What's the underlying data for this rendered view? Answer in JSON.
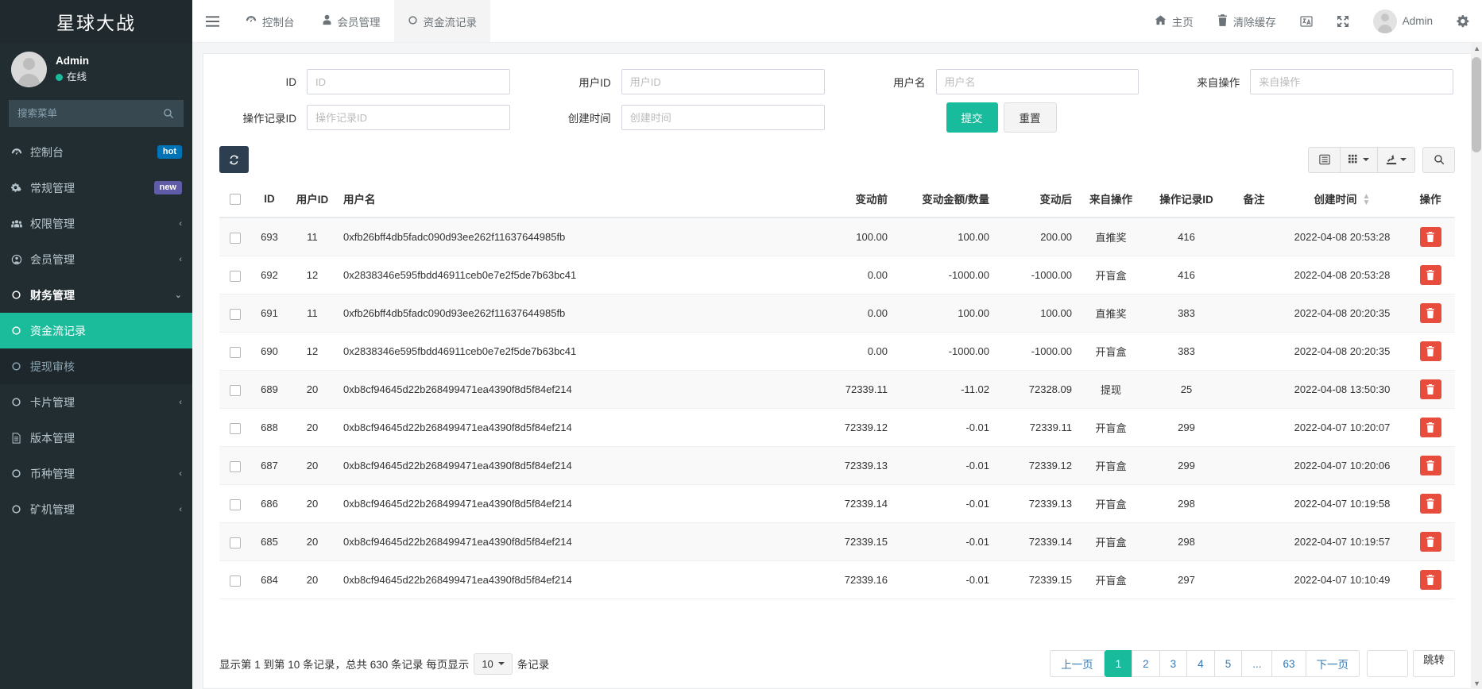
{
  "sidebar": {
    "brand": "星球大战",
    "user": {
      "name": "Admin",
      "status": "在线"
    },
    "search_placeholder": "搜索菜单",
    "items": [
      {
        "label": "控制台",
        "icon": "dashboard-icon",
        "badge": "hot",
        "badge_color": "#0073b7",
        "arrow": ""
      },
      {
        "label": "常规管理",
        "icon": "gears-icon",
        "badge": "new",
        "badge_color": "#605ca8",
        "arrow": ""
      },
      {
        "label": "权限管理",
        "icon": "users-icon",
        "badge": "",
        "arrow": "‹"
      },
      {
        "label": "会员管理",
        "icon": "user-circle-icon",
        "badge": "",
        "arrow": "‹"
      },
      {
        "label": "财务管理",
        "icon": "circle-icon",
        "badge": "",
        "arrow": "⌄"
      },
      {
        "label": "资金流记录",
        "icon": "circle-icon",
        "badge": "",
        "arrow": ""
      },
      {
        "label": "提现审核",
        "icon": "circle-icon",
        "badge": "",
        "arrow": ""
      },
      {
        "label": "卡片管理",
        "icon": "circle-icon",
        "badge": "",
        "arrow": "‹"
      },
      {
        "label": "版本管理",
        "icon": "file-icon",
        "badge": "",
        "arrow": ""
      },
      {
        "label": "币种管理",
        "icon": "circle-icon",
        "badge": "",
        "arrow": "‹"
      },
      {
        "label": "矿机管理",
        "icon": "circle-icon",
        "badge": "",
        "arrow": "‹"
      }
    ],
    "active_index": 5,
    "active_parent_index": 4,
    "dim_index": 6,
    "active_color": "#1abc9c"
  },
  "navbar": {
    "tabs": [
      {
        "label": "控制台",
        "icon": "dashboard-icon"
      },
      {
        "label": "会员管理",
        "icon": "user-icon"
      },
      {
        "label": "资金流记录",
        "icon": "circle-icon"
      }
    ],
    "active_tab": 2,
    "links": [
      {
        "label": "主页",
        "icon": "home-icon"
      },
      {
        "label": "清除缓存",
        "icon": "trash-icon"
      }
    ],
    "icons": [
      "language-icon",
      "fullscreen-icon"
    ],
    "user_label": "Admin",
    "settings_icon": "gear-icon"
  },
  "search_form": {
    "fields": [
      {
        "label": "ID",
        "placeholder": "ID",
        "value": ""
      },
      {
        "label": "用户ID",
        "placeholder": "用户ID",
        "value": ""
      },
      {
        "label": "用户名",
        "placeholder": "用户名",
        "value": ""
      },
      {
        "label": "来自操作",
        "placeholder": "来自操作",
        "value": ""
      },
      {
        "label": "操作记录ID",
        "placeholder": "操作记录ID",
        "value": ""
      },
      {
        "label": "创建时间",
        "placeholder": "创建时间",
        "value": ""
      }
    ],
    "submit_label": "提交",
    "reset_label": "重置"
  },
  "toolbar": {
    "refresh_icon": "refresh-icon",
    "buttons": [
      {
        "icon": "detail-view-icon",
        "caret": false
      },
      {
        "icon": "columns-grid-icon",
        "caret": true
      },
      {
        "icon": "export-icon",
        "caret": true
      },
      {
        "icon": "search-icon",
        "caret": false
      }
    ]
  },
  "table": {
    "columns": [
      "",
      "ID",
      "用户ID",
      "用户名",
      "变动前",
      "变动金额/数量",
      "变动后",
      "来自操作",
      "操作记录ID",
      "备注",
      "创建时间",
      "操作"
    ],
    "sort_column": "创建时间",
    "rows": [
      {
        "id": "693",
        "uid": "11",
        "uname": "0xfb26bff4db5fadc090d93ee262f11637644985fb",
        "before": "100.00",
        "amount": "100.00",
        "after": "200.00",
        "from": "直推奖",
        "opid": "416",
        "remark": "",
        "created": "2022-04-08 20:53:28",
        "action": "delete-icon"
      },
      {
        "id": "692",
        "uid": "12",
        "uname": "0x2838346e595fbdd46911ceb0e7e2f5de7b63bc41",
        "before": "0.00",
        "amount": "-1000.00",
        "after": "-1000.00",
        "from": "开盲盒",
        "opid": "416",
        "remark": "",
        "created": "2022-04-08 20:53:28",
        "action": "delete-icon"
      },
      {
        "id": "691",
        "uid": "11",
        "uname": "0xfb26bff4db5fadc090d93ee262f11637644985fb",
        "before": "0.00",
        "amount": "100.00",
        "after": "100.00",
        "from": "直推奖",
        "opid": "383",
        "remark": "",
        "created": "2022-04-08 20:20:35",
        "action": "delete-icon"
      },
      {
        "id": "690",
        "uid": "12",
        "uname": "0x2838346e595fbdd46911ceb0e7e2f5de7b63bc41",
        "before": "0.00",
        "amount": "-1000.00",
        "after": "-1000.00",
        "from": "开盲盒",
        "opid": "383",
        "remark": "",
        "created": "2022-04-08 20:20:35",
        "action": "delete-icon"
      },
      {
        "id": "689",
        "uid": "20",
        "uname": "0xb8cf94645d22b268499471ea4390f8d5f84ef214",
        "before": "72339.11",
        "amount": "-11.02",
        "after": "72328.09",
        "from": "提现",
        "opid": "25",
        "remark": "",
        "created": "2022-04-08 13:50:30",
        "action": "delete-icon"
      },
      {
        "id": "688",
        "uid": "20",
        "uname": "0xb8cf94645d22b268499471ea4390f8d5f84ef214",
        "before": "72339.12",
        "amount": "-0.01",
        "after": "72339.11",
        "from": "开盲盒",
        "opid": "299",
        "remark": "",
        "created": "2022-04-07 10:20:07",
        "action": "delete-icon"
      },
      {
        "id": "687",
        "uid": "20",
        "uname": "0xb8cf94645d22b268499471ea4390f8d5f84ef214",
        "before": "72339.13",
        "amount": "-0.01",
        "after": "72339.12",
        "from": "开盲盒",
        "opid": "299",
        "remark": "",
        "created": "2022-04-07 10:20:06",
        "action": "delete-icon"
      },
      {
        "id": "686",
        "uid": "20",
        "uname": "0xb8cf94645d22b268499471ea4390f8d5f84ef214",
        "before": "72339.14",
        "amount": "-0.01",
        "after": "72339.13",
        "from": "开盲盒",
        "opid": "298",
        "remark": "",
        "created": "2022-04-07 10:19:58",
        "action": "delete-icon"
      },
      {
        "id": "685",
        "uid": "20",
        "uname": "0xb8cf94645d22b268499471ea4390f8d5f84ef214",
        "before": "72339.15",
        "amount": "-0.01",
        "after": "72339.14",
        "from": "开盲盒",
        "opid": "298",
        "remark": "",
        "created": "2022-04-07 10:19:57",
        "action": "delete-icon"
      },
      {
        "id": "684",
        "uid": "20",
        "uname": "0xb8cf94645d22b268499471ea4390f8d5f84ef214",
        "before": "72339.16",
        "amount": "-0.01",
        "after": "72339.15",
        "from": "开盲盒",
        "opid": "297",
        "remark": "",
        "created": "2022-04-07 10:10:49",
        "action": "delete-icon"
      }
    ]
  },
  "pagination": {
    "info_prefix": "显示第 1 到第 10 条记录，总共 630 条记录 每页显示",
    "page_size": "10",
    "info_suffix": "条记录",
    "prev_label": "上一页",
    "next_label": "下一页",
    "pages": [
      "1",
      "2",
      "3",
      "4",
      "5",
      "...",
      "63"
    ],
    "current_page": "1",
    "jump_value": "",
    "jump_label": "跳转"
  }
}
